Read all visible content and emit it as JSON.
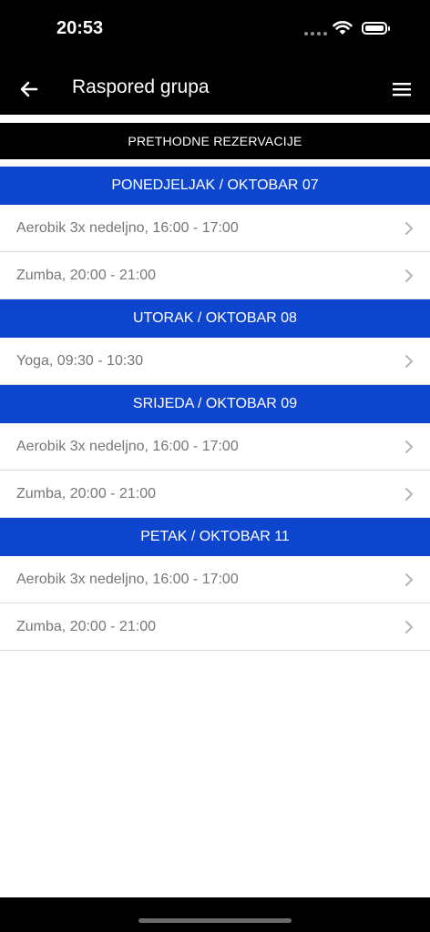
{
  "status_bar": {
    "time": "20:53"
  },
  "header": {
    "title": "Raspored grupa",
    "back_icon": "arrow-left-icon",
    "menu_icon": "hamburger-menu-icon"
  },
  "previous_reservations_label": "PRETHODNE REZERVACIJE",
  "colors": {
    "accent": "#0e45cf",
    "header_bg": "#000000",
    "row_text": "#767676"
  },
  "days": [
    {
      "label": "PONEDJELJAK / OKTOBAR 07",
      "classes": [
        {
          "label": "Aerobik 3x nedeljno, 16:00 - 17:00"
        },
        {
          "label": "Zumba, 20:00 - 21:00"
        }
      ]
    },
    {
      "label": "UTORAK / OKTOBAR 08",
      "classes": [
        {
          "label": "Yoga, 09:30 - 10:30"
        }
      ]
    },
    {
      "label": "SRIJEDA / OKTOBAR 09",
      "classes": [
        {
          "label": "Aerobik 3x nedeljno, 16:00 - 17:00"
        },
        {
          "label": "Zumba, 20:00 - 21:00"
        }
      ]
    },
    {
      "label": "PETAK / OKTOBAR 11",
      "classes": [
        {
          "label": "Aerobik 3x nedeljno, 16:00 - 17:00"
        },
        {
          "label": "Zumba, 20:00 - 21:00"
        }
      ]
    }
  ]
}
